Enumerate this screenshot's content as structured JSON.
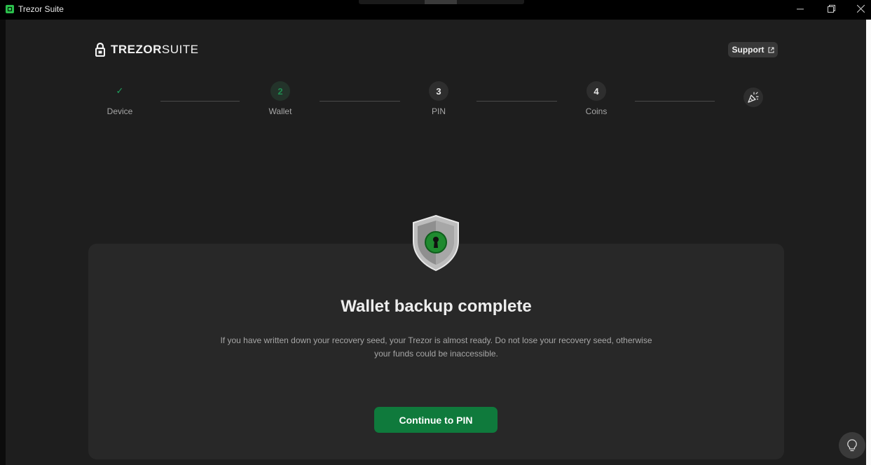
{
  "window": {
    "title": "Trezor Suite",
    "controls": [
      "minimize-icon",
      "restore-icon",
      "close-icon"
    ]
  },
  "header": {
    "logo_bold": "TREZOR",
    "logo_light": "SUITE",
    "support_label": "Support"
  },
  "stepper": {
    "steps": [
      {
        "indicator": "✓",
        "label": "Device",
        "state": "done"
      },
      {
        "indicator": "2",
        "label": "Wallet",
        "state": "active"
      },
      {
        "indicator": "3",
        "label": "PIN",
        "state": "pending"
      },
      {
        "indicator": "4",
        "label": "Coins",
        "state": "pending"
      }
    ],
    "final_icon": "party-popper-icon"
  },
  "main": {
    "icon": "shield-keyhole-icon",
    "title": "Wallet backup complete",
    "description_line1": "If you have written down your recovery seed, your Trezor is almost ready. Do not lose your recovery seed, otherwise",
    "description_line2": "your funds could be inaccessible.",
    "cta_label": "Continue to PIN"
  },
  "tips_icon": "lightbulb-icon",
  "colors": {
    "accent": "#0f7a3c",
    "background": "#1e1e1e",
    "card": "#282828"
  }
}
